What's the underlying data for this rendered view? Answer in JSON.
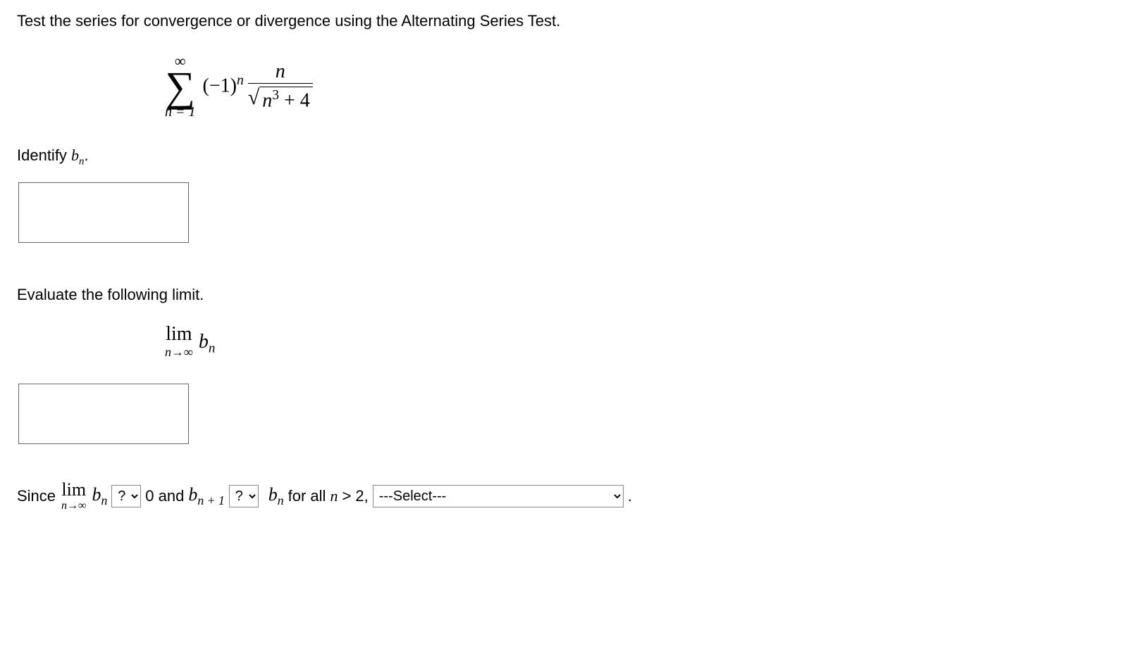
{
  "prompt": "Test the series for convergence or divergence using the Alternating Series Test.",
  "series": {
    "sigma_top": "∞",
    "sigma_bottom": "n = 1",
    "neg1_base": "(−1)",
    "neg1_exp": "n",
    "frac_num": "n",
    "sqrt_inner_var": "n",
    "sqrt_inner_exp": "3",
    "sqrt_inner_tail": " + 4"
  },
  "identify_label": "Identify ",
  "identify_var": "b",
  "identify_sub": "n",
  "identify_period": ".",
  "evaluate_label": "Evaluate the following limit.",
  "limit": {
    "lim": "lim",
    "sub": "n→∞",
    "var": "b",
    "var_sub": "n"
  },
  "final": {
    "since": "Since ",
    "zero_and": " 0 and ",
    "b": "b",
    "sub_n": "n",
    "sub_n1": "n + 1",
    "for_all": " for all ",
    "nvar": "n",
    "gt2": " > 2, ",
    "period": " ."
  },
  "dropdowns": {
    "compare_placeholder": "?",
    "select_placeholder": "---Select---"
  }
}
